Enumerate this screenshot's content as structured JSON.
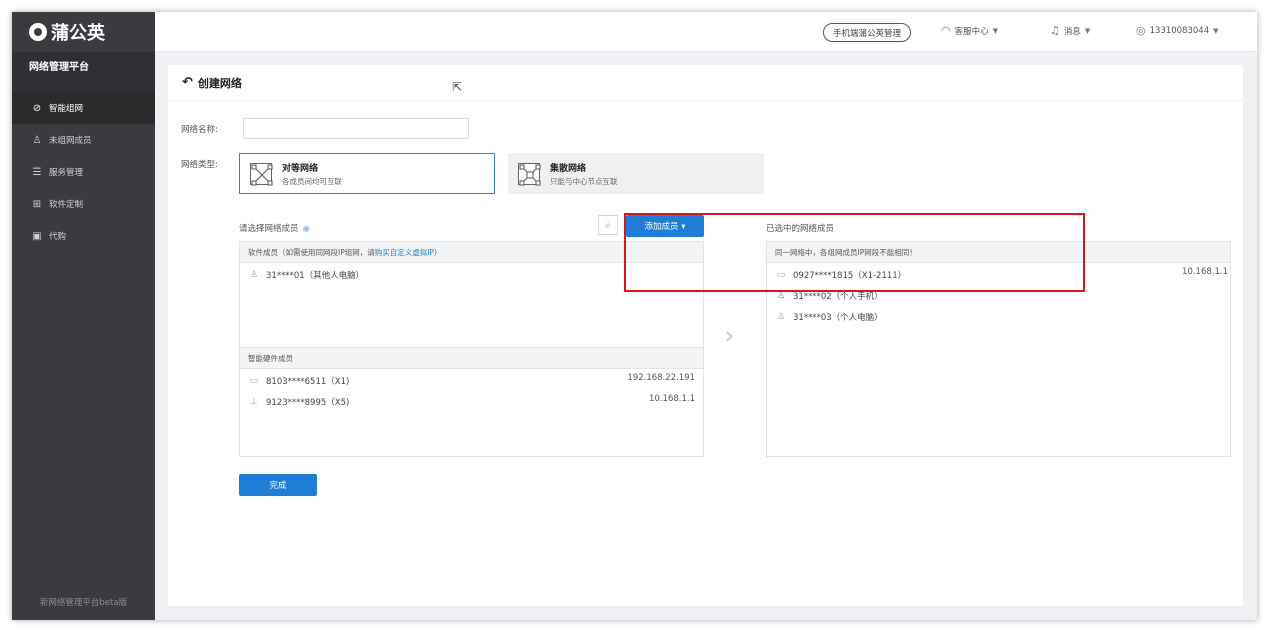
{
  "brand": {
    "logo_text": "蒲公英",
    "platform_title": "网络管理平台"
  },
  "sidebar": {
    "items": [
      {
        "label": "智能组网",
        "icon": "network-icon",
        "active": true
      },
      {
        "label": "未组网成员",
        "icon": "user-icon"
      },
      {
        "label": "服务管理",
        "icon": "list-icon"
      },
      {
        "label": "软件定制",
        "icon": "grid-icon"
      },
      {
        "label": "代购",
        "icon": "cart-icon"
      }
    ],
    "footer": "新网络管理平台beta版"
  },
  "topbar": {
    "mobile_btn": "手机端蒲公英管理",
    "support": "客服中心",
    "messages": "消息",
    "account": "13310083044"
  },
  "page": {
    "title": "创建网络",
    "name_label": "网络名称:",
    "name_value": "",
    "type_label": "网络类型:",
    "types": [
      {
        "title": "对等网络",
        "desc": "各成员间均可互联",
        "selected": true
      },
      {
        "title": "集散网络",
        "desc": "只能与中心节点互联",
        "selected": false
      }
    ]
  },
  "left": {
    "label": "请选择网络成员",
    "add_btn": "添加成员 ▾",
    "software_head_prefix": "软件成员（如需使用同网段IP组网，请 ",
    "software_head_link": "购买自定义虚拟IP",
    "software_head_suffix": " ）",
    "software_members": [
      {
        "name": "31****01（其他人电脑）",
        "icon": "user-icon",
        "ip": ""
      }
    ],
    "hardware_head": "智能硬件成员",
    "hardware_members": [
      {
        "name": "8103****6511（X1)",
        "icon": "router-icon",
        "ip": "192.168.22.191"
      },
      {
        "name": "9123****8995（X5)",
        "icon": "router-icon",
        "ip": "10.168.1.1"
      }
    ]
  },
  "right": {
    "label": "已选中的网络成员",
    "head": "同一网络中，各组网成员IP网段不能相同！",
    "members": [
      {
        "name": "0927****1815（X1-2111）",
        "icon": "router-icon",
        "ip": "10.168.1.1"
      },
      {
        "name": "31****02（个人手机）",
        "icon": "user-icon",
        "ip": ""
      },
      {
        "name": "31****03（个人电脑）",
        "icon": "user-icon",
        "ip": ""
      }
    ]
  },
  "actions": {
    "done": "完成"
  }
}
